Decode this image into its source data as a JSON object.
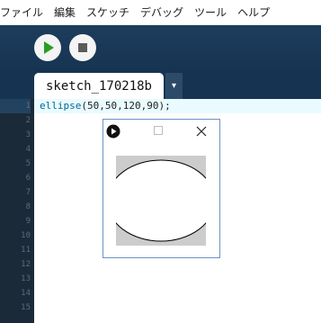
{
  "menu": [
    "ファイル",
    "編集",
    "スケッチ",
    "デバッグ",
    "ツール",
    "ヘルプ"
  ],
  "toolbar": {
    "run_icon": "play-icon",
    "stop_icon": "stop-icon"
  },
  "tab": {
    "label": "sketch_170218b",
    "menu_glyph": "▾"
  },
  "editor": {
    "line_numbers": [
      "1",
      "2",
      "3",
      "4",
      "5",
      "6",
      "7",
      "8",
      "9",
      "10",
      "11",
      "12",
      "13",
      "14",
      "15"
    ],
    "code": {
      "fn": "ellipse",
      "args": "(50,50,120,90);"
    }
  },
  "sketch_window": {
    "app_icon": "processing-icon",
    "maximize_icon": "maximize-icon",
    "close_glyph": "✕",
    "canvas": {
      "background": "#cccccc",
      "shape": "ellipse",
      "fill": "#ffffff",
      "stroke": "#000000"
    }
  }
}
